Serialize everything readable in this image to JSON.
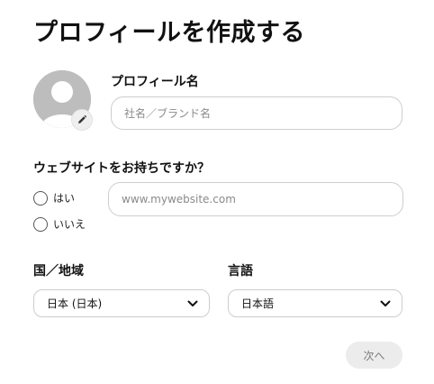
{
  "page": {
    "title": "プロフィールを作成する"
  },
  "profile": {
    "label": "プロフィール名",
    "placeholder": "社名／ブランド名",
    "avatar_icon": "default-avatar-icon",
    "edit_icon": "pencil-icon"
  },
  "website": {
    "question": "ウェブサイトをお持ちですか？",
    "options": [
      "はい",
      "いいえ"
    ],
    "placeholder": "www.mywebsite.com"
  },
  "country": {
    "label": "国／地域",
    "selected": "日本 (日本)"
  },
  "language": {
    "label": "言語",
    "selected": "日本語"
  },
  "actions": {
    "next_label": "次へ"
  },
  "colors": {
    "avatar_bg": "#bdbdbd",
    "button_bg": "#ececec",
    "border": "#cdcdcd"
  }
}
